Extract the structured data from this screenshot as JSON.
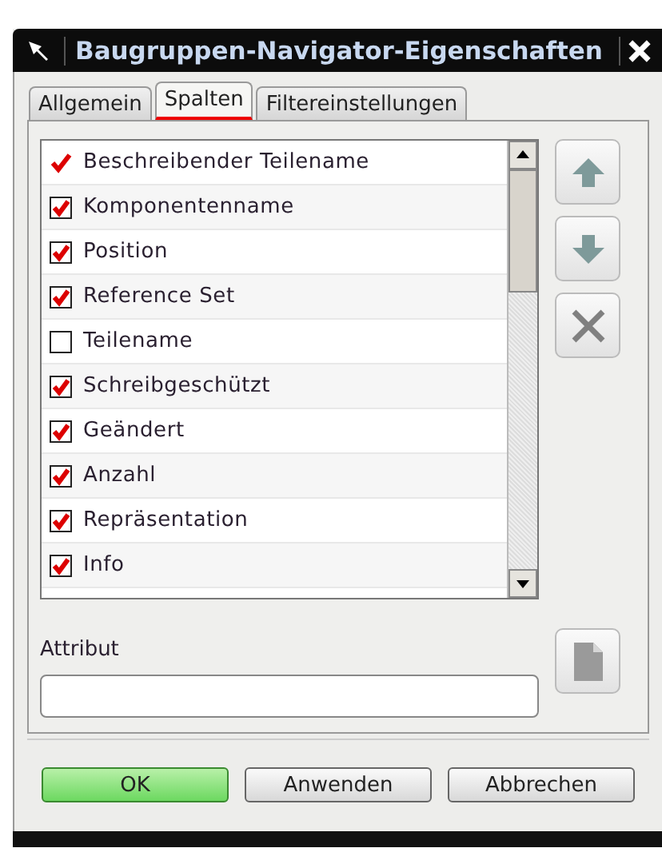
{
  "window": {
    "title": "Baugruppen-Navigator-Eigenschaften"
  },
  "tabs": [
    {
      "label": "Allgemein",
      "selected": false
    },
    {
      "label": "Spalten",
      "selected": true
    },
    {
      "label": "Filtereinstellungen",
      "selected": false
    }
  ],
  "columns": [
    {
      "kind": "tick",
      "label": "Beschreibender Teilename",
      "checked": true
    },
    {
      "kind": "checkbox",
      "label": "Komponentenname",
      "checked": true
    },
    {
      "kind": "checkbox",
      "label": "Position",
      "checked": true
    },
    {
      "kind": "checkbox",
      "label": "Reference Set",
      "checked": true
    },
    {
      "kind": "checkbox",
      "label": "Teilename",
      "checked": false
    },
    {
      "kind": "checkbox",
      "label": "Schreibgeschützt",
      "checked": true
    },
    {
      "kind": "checkbox",
      "label": "Geändert",
      "checked": true
    },
    {
      "kind": "checkbox",
      "label": "Anzahl",
      "checked": true
    },
    {
      "kind": "checkbox",
      "label": "Repräsentation",
      "checked": true
    },
    {
      "kind": "checkbox",
      "label": "Info",
      "checked": true
    }
  ],
  "attribute": {
    "label": "Attribut"
  },
  "buttons": [
    {
      "label": "OK",
      "kind": "default"
    },
    {
      "label": "Anwenden",
      "kind": "normal"
    },
    {
      "label": "Abbrechen",
      "kind": "normal"
    }
  ]
}
